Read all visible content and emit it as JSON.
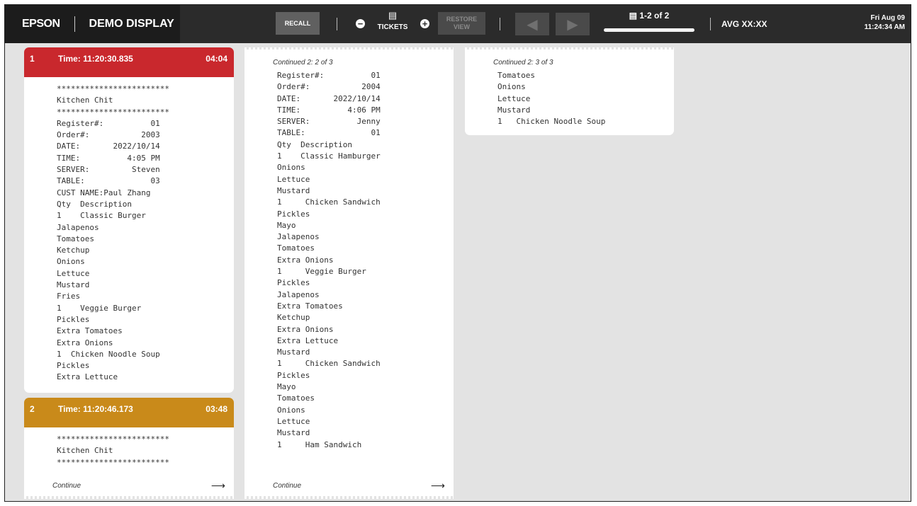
{
  "header": {
    "brand": "EPSON",
    "title": "DEMO DISPLAY",
    "recall_label": "RECALL",
    "minus_symbol": "−",
    "tickets_label": "TICKETS",
    "plus_symbol": "+",
    "restore_line1": "RESTORE",
    "restore_line2": "VIEW",
    "prev_symbol": "◀",
    "next_symbol": "▶",
    "pager_text": "1-2 of 2",
    "avg_text": "AVG XX:XX",
    "date_text": "Fri Aug 09",
    "time_text": "11:24:34 AM"
  },
  "colors": {
    "header_bg": "#2b2b2b",
    "brand_bg": "#1c1c1c",
    "ticket1_head": "#c9282d",
    "ticket2_head": "#c98a1a",
    "canvas_bg": "#e3e3e3"
  },
  "tickets": [
    {
      "number": "1",
      "time": "Time: 11:20:30.835",
      "elapsed": "04:04",
      "lines": "************************\nKitchen Chit\n************************\nRegister#:          01\nOrder#:           2003\nDATE:       2022/10/14\nTIME:          4:05 PM\nSERVER:         Steven\nTABLE:              03\nCUST NAME:Paul Zhang\nQty  Description\n1    Classic Burger\nJalapenos\nTomatoes\nKetchup\nOnions\nLettuce\nMustard\nFries\n1    Veggie Burger\nPickles\nExtra Tomatoes\nExtra Onions\n1  Chicken Noodle Soup\nPickles\nExtra Lettuce"
    },
    {
      "number": "2",
      "time": "Time: 11:20:46.173",
      "elapsed": "03:48",
      "lines": "************************\nKitchen Chit\n************************",
      "continue_label": "Continue"
    }
  ],
  "continuations": [
    {
      "label": "Continued 2: 2 of 3",
      "lines": "Register#:          01\nOrder#:           2004\nDATE:       2022/10/14\nTIME:          4:06 PM\nSERVER:          Jenny\nTABLE:              01\nQty  Description\n1    Classic Hamburger\nOnions\nLettuce\nMustard\n1     Chicken Sandwich\nPickles\nMayo\nJalapenos\nTomatoes\nExtra Onions\n1     Veggie Burger\nPickles\nJalapenos\nExtra Tomatoes\nKetchup\nExtra Onions\nExtra Lettuce\nMustard\n1     Chicken Sandwich\nPickles\nMayo\nTomatoes\nOnions\nLettuce\nMustard\n1     Ham Sandwich",
      "continue_label": "Continue"
    },
    {
      "label": "Continued 2: 3 of 3",
      "lines": "Tomatoes\nOnions\nLettuce\nMustard\n1   Chicken Noodle Soup"
    }
  ]
}
